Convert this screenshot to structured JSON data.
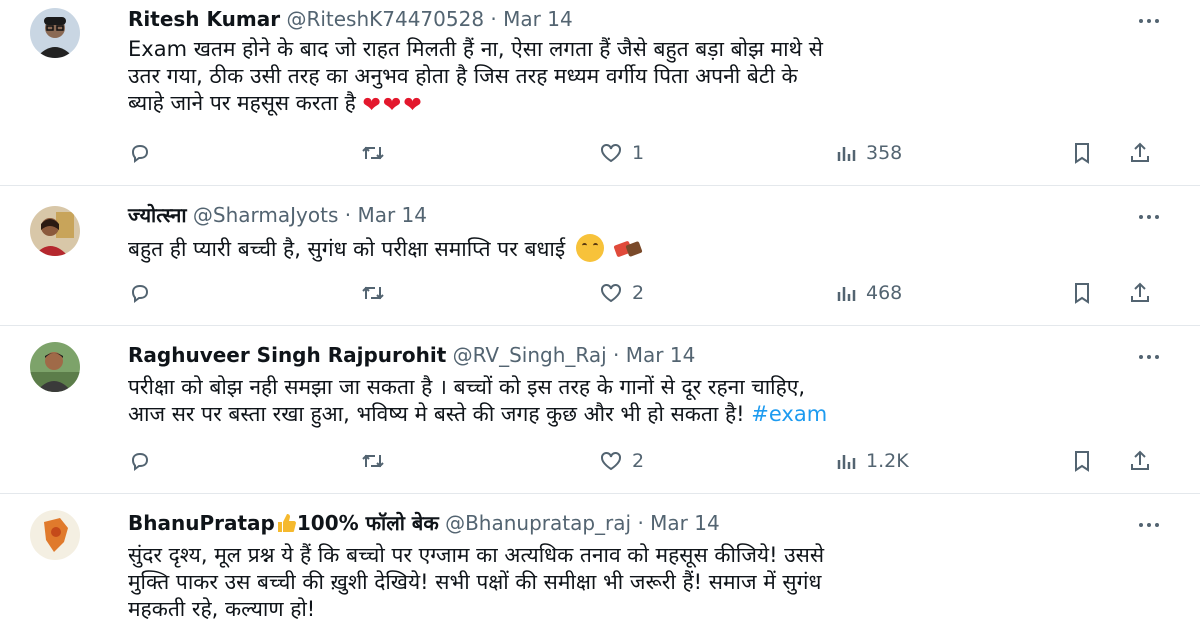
{
  "tweets": [
    {
      "name": "Ritesh Kumar",
      "handle": "@RiteshK74470528",
      "sep": "·",
      "date": "Mar 14",
      "lines": [
        "Exam खतम होने के बाद जो राहत मिलती हैं ना, ऐसा लगता हैं जैसे  बहुत बड़ा बोझ माथे से",
        "उतर गया, ठीक उसी तरह का अनुभव होता है जिस तरह मध्यम वर्गीय पिता अपनी बेटी के",
        "ब्याहे जाने पर महसूस करता है"
      ],
      "trailing_emoji": "❤❤❤",
      "replies": "",
      "retweets": "",
      "likes": "1",
      "views": "358"
    },
    {
      "name": "ज्योत्स्ना",
      "handle": "@SharmaJyots",
      "sep": "·",
      "date": "Mar 14",
      "lines": [
        "बहुत ही प्यारी बच्ची है, सुगंध को परीक्षा समाप्ति पर बधाई"
      ],
      "replies": "",
      "retweets": "",
      "likes": "2",
      "views": "468"
    },
    {
      "name": "Raghuveer Singh Rajpurohit",
      "handle": "@RV_Singh_Raj",
      "sep": "·",
      "date": "Mar 14",
      "lines": [
        "परीक्षा को बोझ नही समझा जा सकता है । बच्चों को इस तरह के गानों से दूर रहना चाहिए,",
        "आज सर पर बस्ता रखा हुआ, भविष्य मे बस्ते की जगह कुछ और भी हो सकता है!"
      ],
      "hashtag": "#exam",
      "replies": "",
      "retweets": "",
      "likes": "2",
      "views": "1.2K"
    },
    {
      "name_part1": "BhanuPratap",
      "name_part2": "100% फॉलो बेक",
      "handle": "@Bhanupratap_raj",
      "sep": "·",
      "date": "Mar 14",
      "lines": [
        "सुंदर दृश्य, मूल प्रश्न ये हैं कि बच्चो पर एग्जाम का अत्यधिक तनाव को महसूस कीजिये! उससे",
        "मुक्ति पाकर उस बच्ची की ख़ुशी देखिये! सभी पक्षों की समीक्षा भी जरूरी हैं!  समाज में सुगंध",
        "महकती रहे, कल्याण हो!"
      ]
    }
  ],
  "colors": {
    "text": "#0f1419",
    "muted": "#536471",
    "link": "#1d9bf0",
    "heart": "#e3182d"
  },
  "icons": [
    "reply-icon",
    "retweet-icon",
    "like-icon",
    "views-icon",
    "bookmark-icon",
    "share-icon",
    "more-icon"
  ]
}
